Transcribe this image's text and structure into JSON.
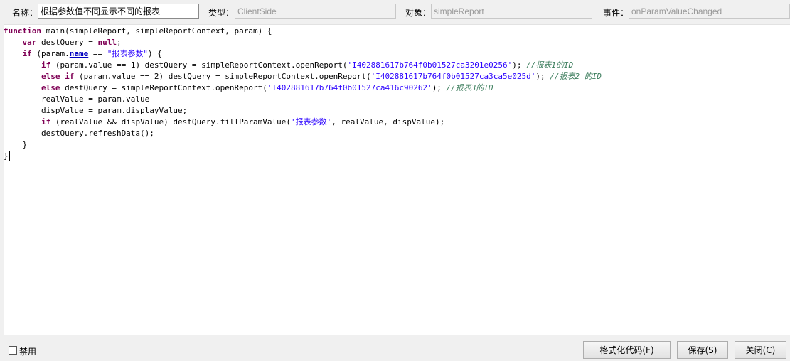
{
  "form": {
    "name_label": "名称：",
    "name_value": "根据参数值不同显示不同的报表",
    "type_label": "类型：",
    "type_value": "ClientSide",
    "object_label": "对象：",
    "object_value": "simpleReport",
    "event_label": "事件：",
    "event_value": "onParamValueChanged"
  },
  "code": {
    "lines": [
      [
        [
          "kw",
          "function"
        ],
        [
          "t",
          " main(simpleReport, simpleReportContext, param) {"
        ]
      ],
      [
        [
          "t",
          "    "
        ],
        [
          "kw",
          "var"
        ],
        [
          "t",
          " destQuery = "
        ],
        [
          "kw",
          "null"
        ],
        [
          "t",
          ";"
        ]
      ],
      [
        [
          "t",
          "    "
        ],
        [
          "kw",
          "if"
        ],
        [
          "t",
          " (param."
        ],
        [
          "prop",
          "name"
        ],
        [
          "t",
          " == "
        ],
        [
          "str",
          "\"报表参数\""
        ],
        [
          "t",
          ") {"
        ]
      ],
      [
        [
          "t",
          "        "
        ],
        [
          "kw",
          "if"
        ],
        [
          "t",
          " (param.value == 1) destQuery = simpleReportContext.openReport("
        ],
        [
          "str",
          "'I402881617b764f0b01527ca3201e0256'"
        ],
        [
          "t",
          "); "
        ],
        [
          "cmt",
          "//报表1的ID"
        ]
      ],
      [
        [
          "t",
          "        "
        ],
        [
          "kw",
          "else if"
        ],
        [
          "t",
          " (param.value == 2) destQuery = simpleReportContext.openReport("
        ],
        [
          "str",
          "'I402881617b764f0b01527ca3ca5e025d'"
        ],
        [
          "t",
          "); "
        ],
        [
          "cmt",
          "//报表2 的ID"
        ]
      ],
      [
        [
          "t",
          "        "
        ],
        [
          "kw",
          "else"
        ],
        [
          "t",
          " destQuery = simpleReportContext.openReport("
        ],
        [
          "str",
          "'I402881617b764f0b01527ca416c90262'"
        ],
        [
          "t",
          "); "
        ],
        [
          "cmt",
          "//报表3的ID"
        ]
      ],
      [
        [
          "t",
          "        realValue = param.value"
        ]
      ],
      [
        [
          "t",
          "        dispValue = param.displayValue;"
        ]
      ],
      [
        [
          "t",
          "        "
        ],
        [
          "kw",
          "if"
        ],
        [
          "t",
          " (realValue && dispValue) destQuery.fillParamValue("
        ],
        [
          "str",
          "'报表参数'"
        ],
        [
          "t",
          ", realValue, dispValue);"
        ]
      ],
      [
        [
          "t",
          "        destQuery.refreshData();"
        ]
      ],
      [
        [
          "t",
          "    }"
        ]
      ],
      [
        [
          "t",
          "}"
        ],
        [
          "caret",
          ""
        ]
      ]
    ]
  },
  "footer": {
    "disable_label": "禁用",
    "disable_checked": false,
    "format_button": "格式化代码(F)",
    "save_button": "保存(S)",
    "close_button": "关闭(C)"
  }
}
